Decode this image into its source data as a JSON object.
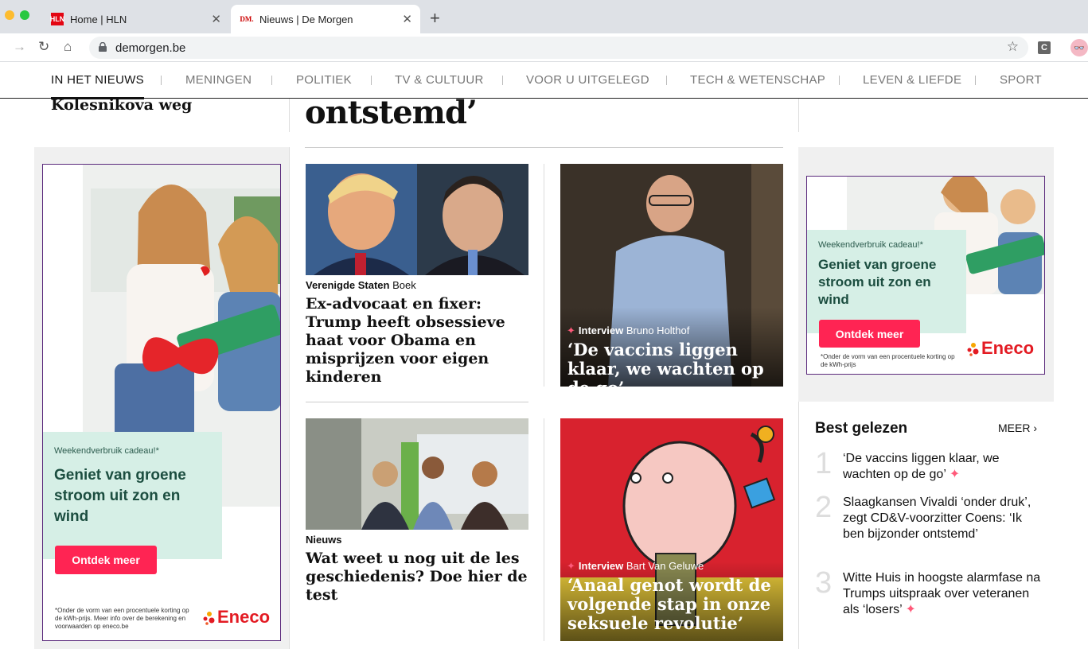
{
  "browser": {
    "tabs": [
      {
        "label": "Home | HLN",
        "favicon": "HLN"
      },
      {
        "label": "Nieuws | De Morgen",
        "favicon": "DM."
      }
    ],
    "url": "demorgen.be",
    "ext_label": "C",
    "avatar": "👓"
  },
  "nav": {
    "items": [
      "IN HET NIEUWS",
      "MENINGEN",
      "POLITIEK",
      "TV & CULTUUR",
      "VOOR U UITGELEGD",
      "TECH & WETENSCHAP",
      "LEVEN & LIEFDE",
      "SPORT"
    ]
  },
  "top": {
    "left_headline": "Kolesnikova weg",
    "main_headline": "ontstemd’"
  },
  "articles": [
    {
      "kicker_bold": "Verenigde Staten",
      "kicker_rest": " Boek",
      "title": "Ex-advocaat en fixer: Trump heeft obsessieve haat voor Obama en misprijzen voor eigen kinderen"
    },
    {
      "kicker_bold": "Interview",
      "kicker_rest": " Bruno Holthof",
      "title": "‘De vaccins liggen klaar, we wachten op de go’"
    },
    {
      "kicker_bold": "Nieuws",
      "kicker_rest": "",
      "title": "Wat weet u nog uit de les geschiedenis? Doe hier de test"
    },
    {
      "kicker_bold": "Interview",
      "kicker_rest": " Bart Van Geluwe",
      "title": "‘Anaal genot wordt de volgende stap in onze seksuele revolutie’"
    }
  ],
  "ad_left": {
    "small": "Weekendverbruik cadeau!*",
    "big": "Geniet van groene stroom uit zon en wind",
    "cta": "Ontdek meer",
    "disclaimer": "*Onder de vorm van een procentuele korting op de kWh-prijs. Meer info over de berekening en voorwaarden op eneco.be",
    "brand": "Eneco"
  },
  "ad_right": {
    "small": "Weekendverbruik cadeau!*",
    "big": "Geniet van groene stroom uit zon en wind",
    "cta": "Ontdek meer",
    "disclaimer": "*Onder de vorm van een procentuele korting op de kWh-prijs",
    "brand": "Eneco"
  },
  "best": {
    "label": "Best gelezen",
    "more": "MEER",
    "items": [
      {
        "rank": "1",
        "text": "‘De vaccins liggen klaar, we wachten op de go’"
      },
      {
        "rank": "2",
        "text": "Slaagkansen Vivaldi ‘onder druk’, zegt CD&V-voorzitter Coens: ‘Ik ben bijzonder ontstemd’"
      },
      {
        "rank": "3",
        "text": "Witte Huis in hoogste alarmfase na Trumps uitspraak over veteranen als ‘losers’"
      }
    ]
  },
  "colors": {
    "accent": "#ff2453",
    "promo_bg": "#d6efe6",
    "brand": "#e31b23"
  }
}
